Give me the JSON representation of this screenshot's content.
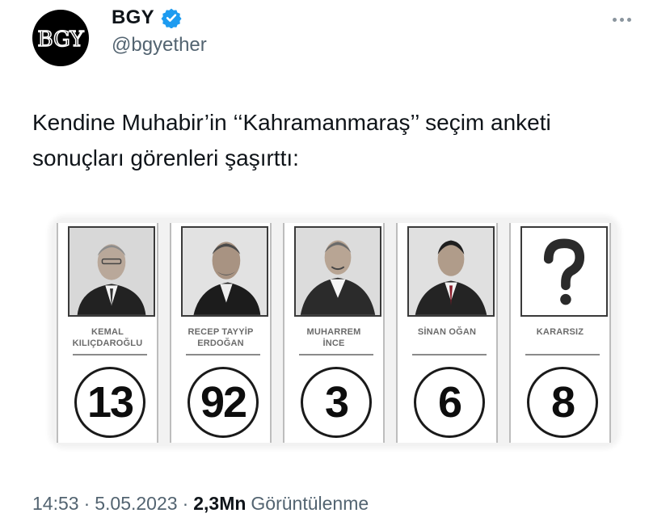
{
  "author": {
    "display_name": "BGY",
    "handle": "@bgyether",
    "avatar_logo_text": "BGY",
    "verified": true
  },
  "tweet": {
    "text": "Kendine Muhabir’in ‘‘Kahramanmaraş’’ seçim anketi sonuçları görenleri şaşırttı:"
  },
  "ballot": {
    "candidates": [
      {
        "name": "KEMAL\nKILIÇDAROĞLU",
        "votes": "13",
        "portrait": "person-photo"
      },
      {
        "name": "RECEP TAYYİP\nERDOĞAN",
        "votes": "92",
        "portrait": "person-photo"
      },
      {
        "name": "MUHARREM\nİNCE",
        "votes": "3",
        "portrait": "person-photo"
      },
      {
        "name": "SİNAN OĞAN",
        "votes": "6",
        "portrait": "person-photo"
      },
      {
        "name": "KARARSIZ",
        "votes": "8",
        "portrait": "question-mark-icon"
      }
    ]
  },
  "meta": {
    "time": "14:53",
    "separator": "·",
    "date": "5.05.2023",
    "views_count": "2,3Mn",
    "views_label": "Görüntülenme"
  },
  "colors": {
    "text": "#0f1419",
    "secondary": "#536471",
    "verified_blue": "#1d9bf0"
  }
}
